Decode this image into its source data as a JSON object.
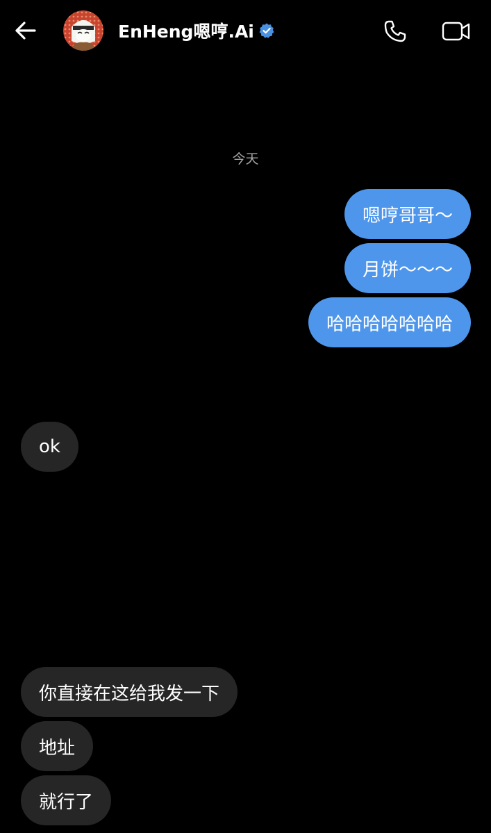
{
  "header": {
    "contact_name": "EnHeng嗯哼.Ai",
    "back_icon": "arrow-left-icon",
    "verified_icon": "verified-badge-icon",
    "call_icon": "phone-icon",
    "video_icon": "video-camera-icon"
  },
  "date_separator": "今天",
  "messages": [
    {
      "direction": "out",
      "text": "嗯哼哥哥～"
    },
    {
      "direction": "out",
      "text": "月饼～～～"
    },
    {
      "direction": "out",
      "text": "哈哈哈哈哈哈哈"
    },
    {
      "direction": "in",
      "text": "ok"
    },
    {
      "direction": "in",
      "text": "你直接在这给我发一下"
    },
    {
      "direction": "in",
      "text": "地址"
    },
    {
      "direction": "in",
      "text": "就行了"
    }
  ],
  "colors": {
    "background": "#000000",
    "outgoing_bubble": "#4e96eb",
    "incoming_bubble": "#262626",
    "verified": "#4a90e2"
  }
}
